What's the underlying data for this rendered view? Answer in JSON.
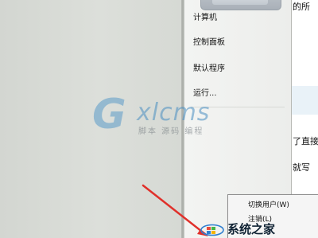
{
  "start_menu": {
    "right_pane": {
      "items": [
        {
          "label": "计算机"
        },
        {
          "label": "控制面板"
        },
        {
          "label": "默认程序"
        },
        {
          "label": "运行..."
        }
      ]
    },
    "shutdown_flyout": {
      "items": [
        {
          "label": "切换用户(W)"
        },
        {
          "label": "注销(L)"
        }
      ]
    }
  },
  "background_document": {
    "fragments": [
      "的所",
      "了直接",
      "就写"
    ]
  },
  "watermarks": {
    "gxlcms": {
      "letter": "G",
      "rest": "xlcms",
      "subtitle": "脚本 源码 编程"
    },
    "site": {
      "text": "系统之家"
    }
  },
  "colors": {
    "arrow": "#e0302a",
    "watermark_blue": "#4a8fc2"
  }
}
